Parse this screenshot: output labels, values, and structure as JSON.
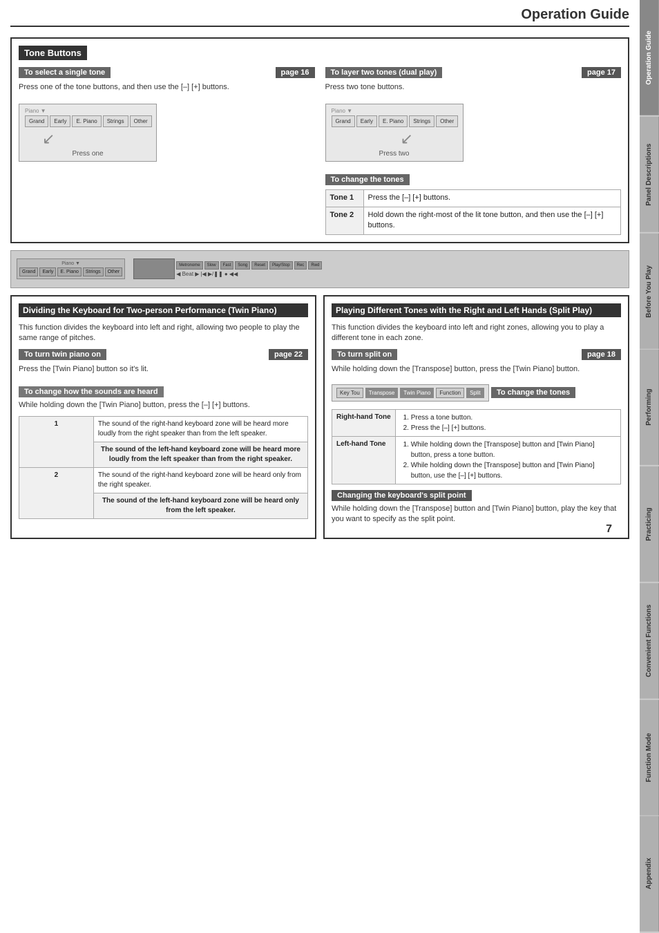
{
  "header": {
    "title": "Operation Guide"
  },
  "sidebar": {
    "tabs": [
      {
        "label": "Operation Guide",
        "active": true
      },
      {
        "label": "Panel Descriptions",
        "active": false
      },
      {
        "label": "Before You Play",
        "active": false
      },
      {
        "label": "Performing",
        "active": false
      },
      {
        "label": "Practicing",
        "active": false
      },
      {
        "label": "Convenient Functions",
        "active": false
      },
      {
        "label": "Function Mode",
        "active": false
      },
      {
        "label": "Appendix",
        "active": false
      }
    ]
  },
  "tone_buttons": {
    "section_title": "Tone Buttons",
    "single_tone": {
      "title": "To select a single tone",
      "page": "page 16",
      "instruction": "Press one of the tone buttons, and then use the [–] [+] buttons.",
      "press_label": "Press one",
      "keyboard": {
        "label": "Piano",
        "buttons": [
          "Grand",
          "Early",
          "E. Piano",
          "Strings",
          "Other"
        ]
      }
    },
    "dual_play": {
      "title": "To layer two tones (dual play)",
      "page": "page 17",
      "instruction": "Press two tone buttons.",
      "press_label": "Press two",
      "keyboard": {
        "label": "Piano",
        "buttons": [
          "Grand",
          "Early",
          "E. Piano",
          "Strings",
          "Other"
        ]
      }
    },
    "change_tones": {
      "title": "To change the tones",
      "tone1_label": "Tone 1",
      "tone1_desc": "Press the [–] [+] buttons.",
      "tone2_label": "Tone 2",
      "tone2_desc": "Hold down the right-most of the lit tone button, and then use the [–] [+] buttons."
    }
  },
  "twin_piano": {
    "section_title": "Dividing the Keyboard for Two-person Performance (Twin Piano)",
    "intro": "This function divides the keyboard into left and right, allowing two people to play the same range of pitches.",
    "turn_on": {
      "title": "To turn twin piano on",
      "page": "page 22",
      "instruction": "Press the [Twin Piano] button so it's lit."
    },
    "change_sounds": {
      "title": "To change how the sounds are heard",
      "instruction": "While holding down the [Twin Piano] button, press the [–] [+] buttons.",
      "table": {
        "rows": [
          {
            "number": "1",
            "cells": [
              "The sound of the right-hand keyboard zone will be heard more loudly from the right speaker than from the left speaker.",
              "The sound of the left-hand keyboard zone will be heard more loudly from the left speaker than from the right speaker."
            ]
          },
          {
            "number": "2",
            "cells": [
              "The sound of the right-hand keyboard zone will be heard only from the right speaker.",
              "The sound of the left-hand keyboard zone will be heard only from the left speaker."
            ]
          }
        ]
      }
    }
  },
  "split_play": {
    "section_title": "Playing Different Tones with the Right and Left Hands (Split Play)",
    "intro": "This function divides the keyboard into left and right zones, allowing you to play a different tone in each zone.",
    "turn_on": {
      "title": "To turn split on",
      "page": "page 18",
      "instruction": "While holding down the [Transpose] button, press the [Twin Piano] button.",
      "keyboard": {
        "buttons": [
          "Key Tou",
          "Transpose",
          "Twin Piano",
          "Function",
          "Split"
        ]
      }
    },
    "change_tones": {
      "title": "To change the tones",
      "right_hand_label": "Right-hand Tone",
      "right_hand_steps": [
        "Press a tone button.",
        "Press the [–] [+] buttons."
      ],
      "left_hand_label": "Left-hand Tone",
      "left_hand_steps": [
        "While holding down the [Transpose] button and [Twin Piano] button, press a tone button.",
        "While holding down the [Transpose] button and [Twin Piano] button, use the [–] [+] buttons."
      ]
    },
    "split_point": {
      "title": "Changing the keyboard's split point",
      "instruction": "While holding down the [Transpose] button and [Twin Piano] button, play the key that you want to specify as the split point."
    }
  },
  "page_number": "7"
}
